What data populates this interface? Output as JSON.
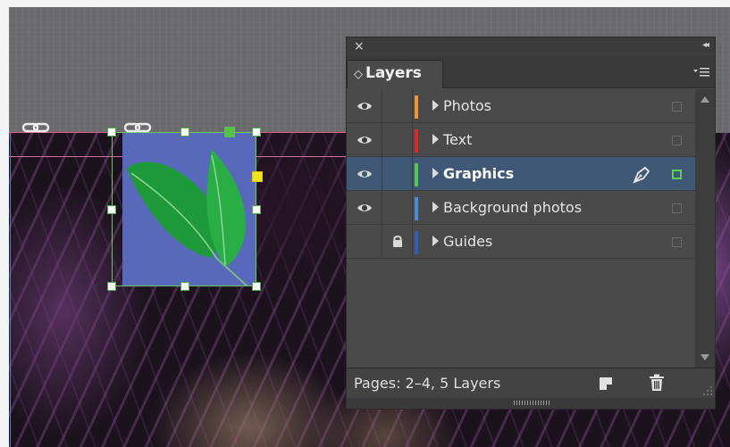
{
  "panel": {
    "close_glyph": "×",
    "collapse_glyph": "◂◂",
    "tab_label": "Layers",
    "tab_chevron": "◇"
  },
  "layers": [
    {
      "name": "Photos",
      "color": "#f0962a",
      "visible": true,
      "locked": false,
      "selected": false
    },
    {
      "name": "Text",
      "color": "#e02828",
      "visible": true,
      "locked": false,
      "selected": false
    },
    {
      "name": "Graphics",
      "color": "#56c84c",
      "visible": true,
      "locked": false,
      "selected": true
    },
    {
      "name": "Background photos",
      "color": "#4a8ad8",
      "visible": true,
      "locked": false,
      "selected": false
    },
    {
      "name": "Guides",
      "color": "#2f5fb8",
      "visible": false,
      "locked": true,
      "selected": false
    }
  ],
  "footer": {
    "status": "Pages: 2–4, 5 Layers"
  },
  "icons": {
    "eye": "eye-icon",
    "lock": "lock-icon",
    "pen": "pen-icon",
    "new_layer": "new-layer-icon",
    "trash": "trash-icon",
    "menu": "panel-menu-icon"
  }
}
